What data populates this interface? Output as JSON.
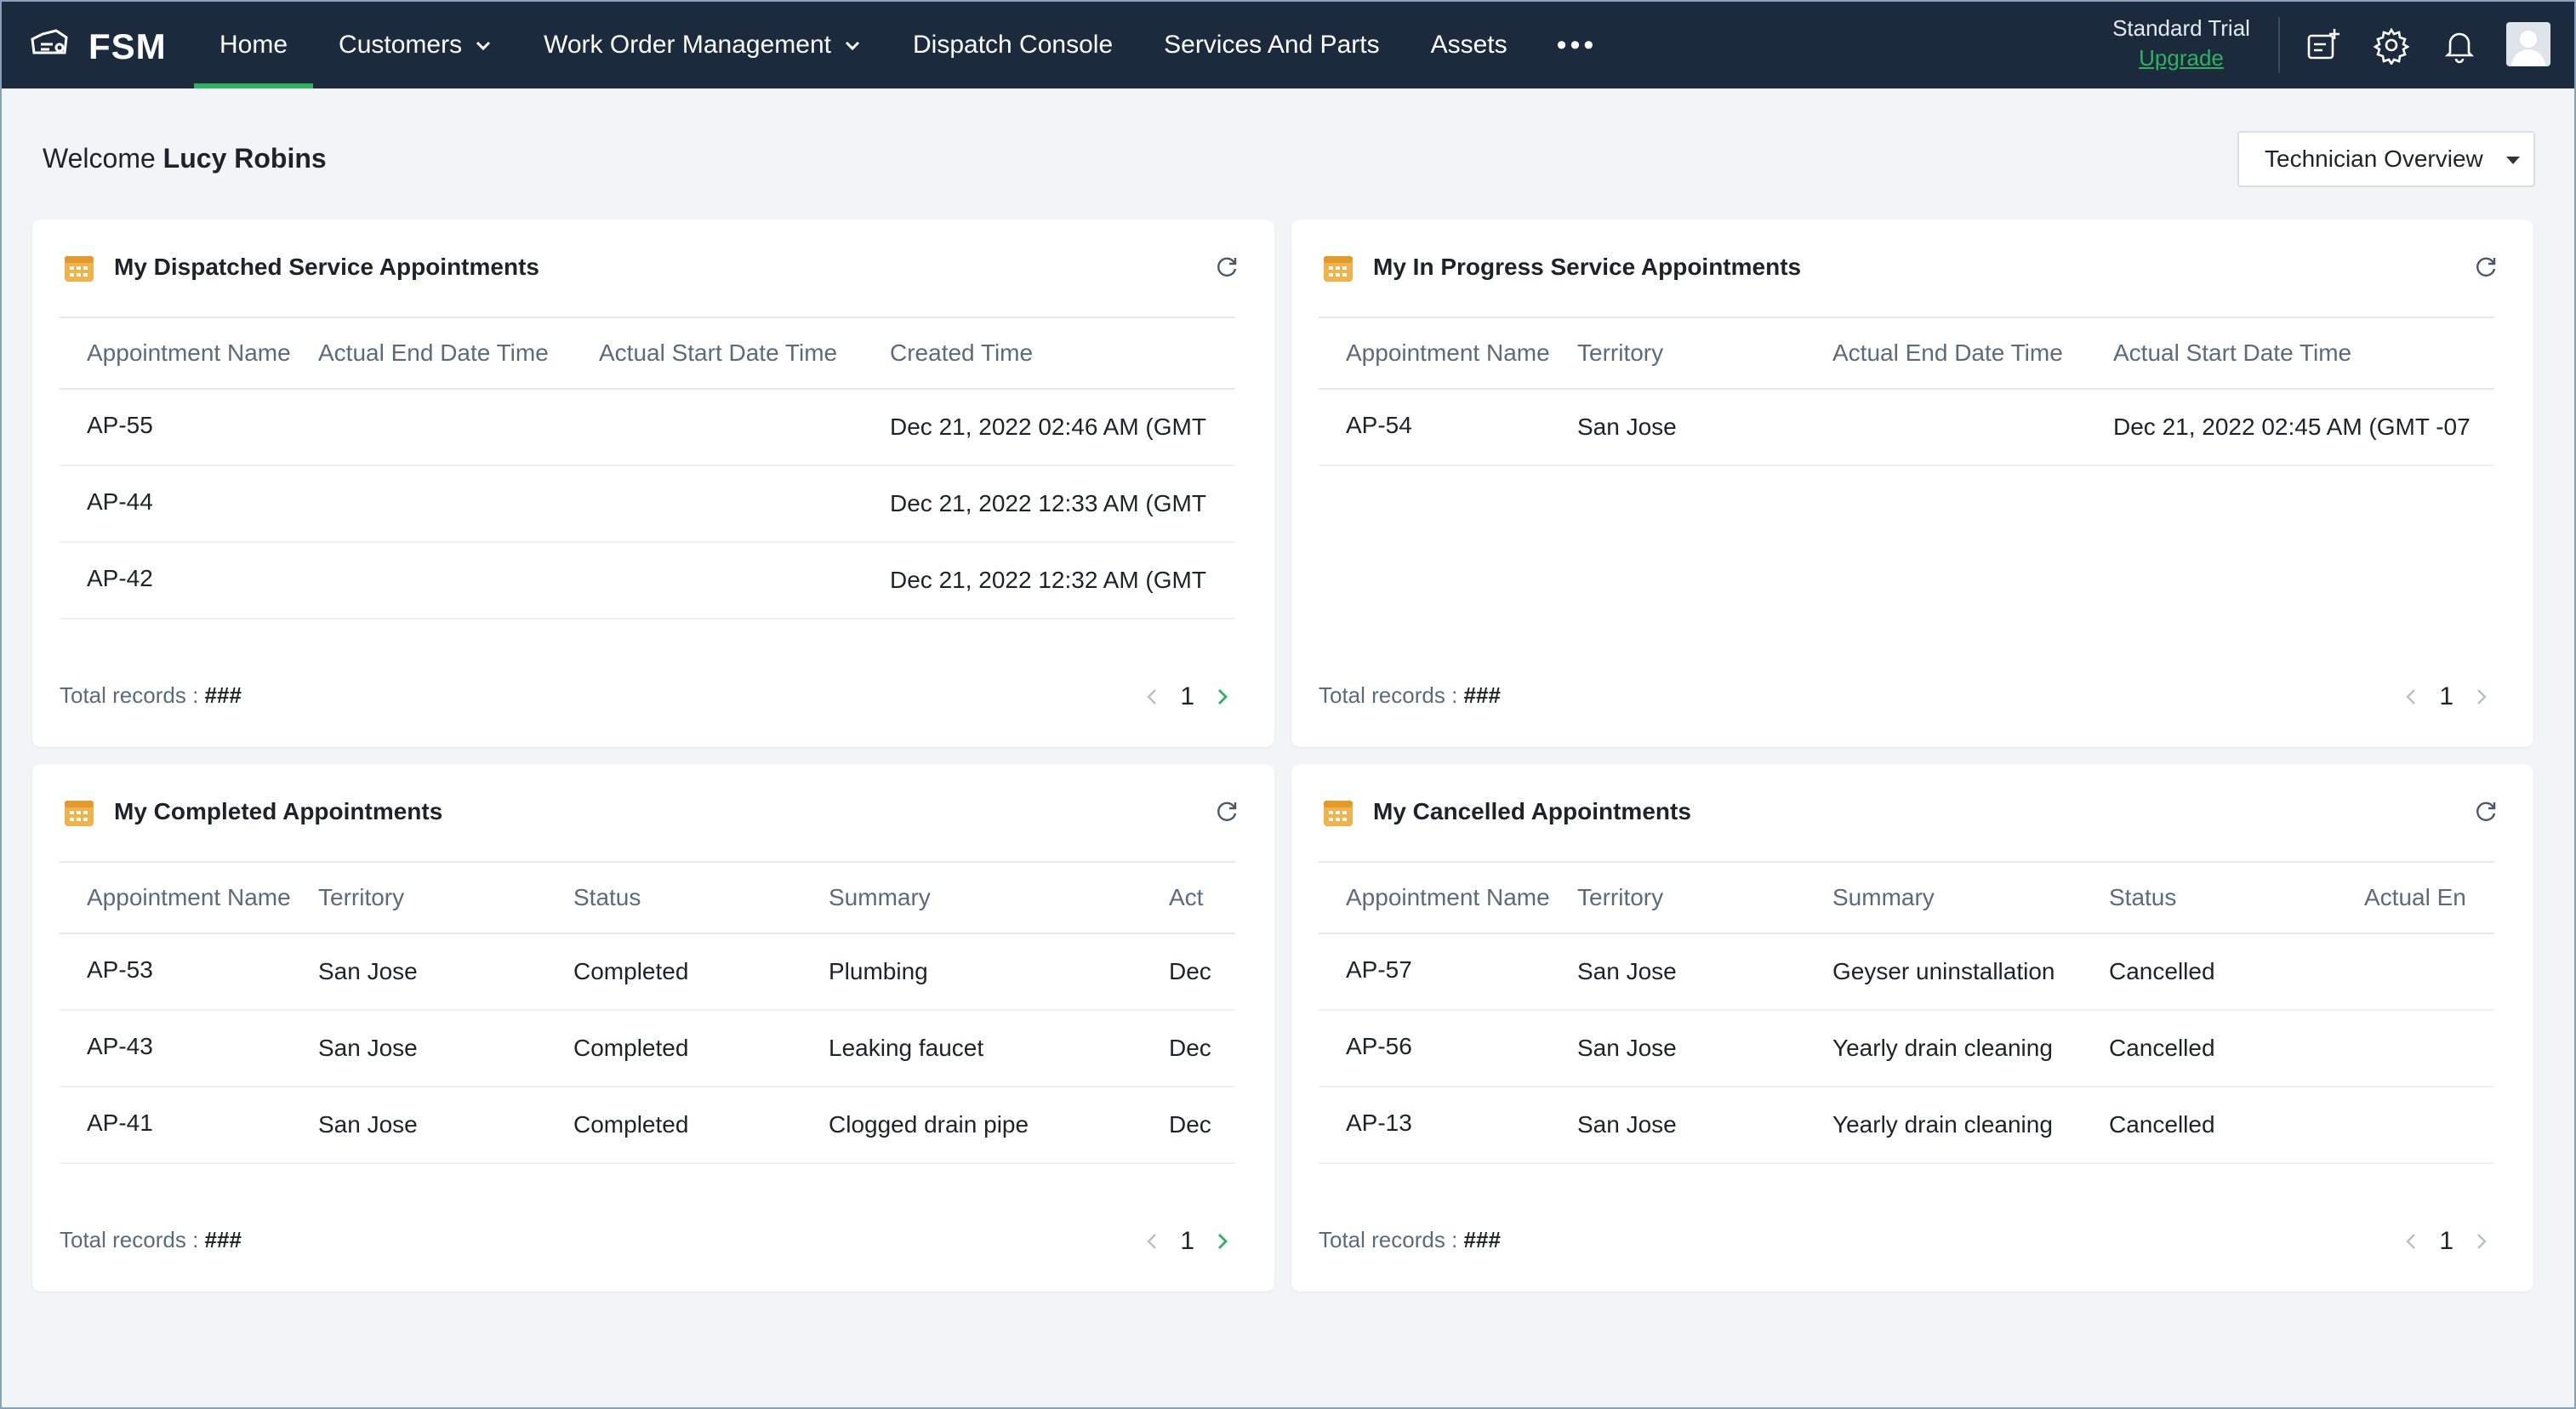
{
  "app": {
    "brand": "FSM",
    "nav": [
      "Home",
      "Customers",
      "Work Order Management",
      "Dispatch Console",
      "Services And Parts",
      "Assets"
    ],
    "more": "•••",
    "trial_label": "Standard Trial",
    "upgrade_label": "Upgrade",
    "accent": "#2fb160",
    "nav_bg": "#1c2a3e"
  },
  "welcome": {
    "prefix": "Welcome",
    "user": "Lucy Robins"
  },
  "view_select": {
    "value": "Technician Overview"
  },
  "cards": [
    {
      "title": "My Dispatched Service Appointments",
      "columns": [
        "Appointment Name",
        "Actual End Date Time",
        "Actual Start Date Time",
        "Created Time"
      ],
      "rows": [
        [
          "AP-55",
          "",
          "",
          "Dec 21, 2022 02:46 AM (GMT"
        ],
        [
          "AP-44",
          "",
          "",
          "Dec 21, 2022 12:33 AM (GMT"
        ],
        [
          "AP-42",
          "",
          "",
          "Dec 21, 2022 12:32 AM (GMT"
        ]
      ],
      "total_label": "Total records :",
      "total_value": "###",
      "page": "1"
    },
    {
      "title": "My In Progress Service Appointments",
      "columns": [
        "Appointment Name",
        "Territory",
        "Actual End Date Time",
        "Actual Start Date Time"
      ],
      "rows": [
        [
          "AP-54",
          "San Jose",
          "",
          "Dec 21, 2022 02:45 AM (GMT -07"
        ]
      ],
      "total_label": "Total records :",
      "total_value": "###",
      "page": "1"
    },
    {
      "title": "My Completed Appointments",
      "columns": [
        "Appointment Name",
        "Territory",
        "Status",
        "Summary",
        "Act"
      ],
      "rows": [
        [
          "AP-53",
          "San Jose",
          "Completed",
          "Plumbing",
          "Dec"
        ],
        [
          "AP-43",
          "San Jose",
          "Completed",
          "Leaking faucet",
          "Dec"
        ],
        [
          "AP-41",
          "San Jose",
          "Completed",
          "Clogged drain pipe",
          "Dec"
        ]
      ],
      "total_label": "Total records :",
      "total_value": "###",
      "page": "1"
    },
    {
      "title": "My Cancelled Appointments",
      "columns": [
        "Appointment Name",
        "Territory",
        "Summary",
        "Status",
        "Actual En"
      ],
      "rows": [
        [
          "AP-57",
          "San Jose",
          "Geyser uninstallation",
          "Cancelled",
          ""
        ],
        [
          "AP-56",
          "San Jose",
          "Yearly drain cleaning",
          "Cancelled",
          ""
        ],
        [
          "AP-13",
          "San Jose",
          "Yearly drain cleaning",
          "Cancelled",
          ""
        ]
      ],
      "total_label": "Total records :",
      "total_value": "###",
      "page": "1"
    }
  ]
}
